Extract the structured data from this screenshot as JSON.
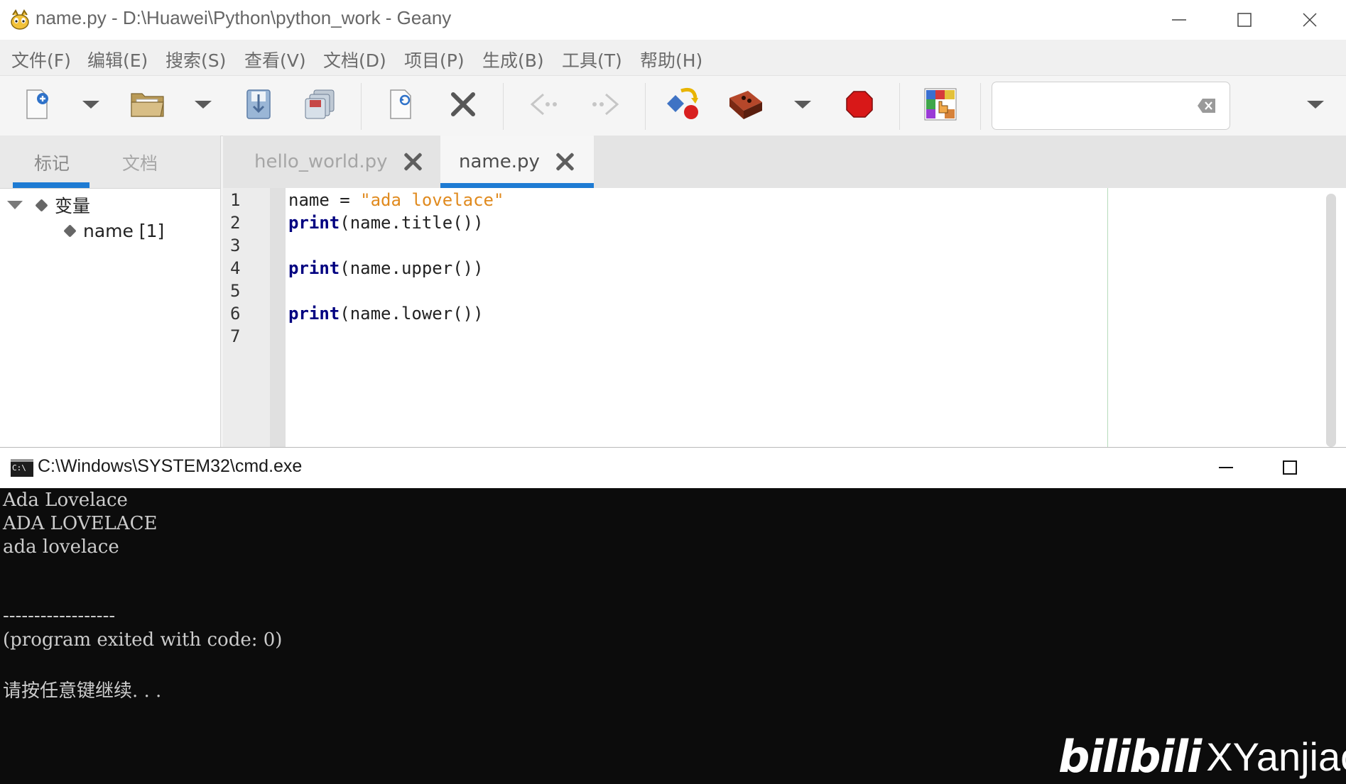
{
  "geany": {
    "title": "name.py - D:\\Huawei\\Python\\python_work - Geany",
    "menu": [
      "文件(F)",
      "编辑(E)",
      "搜索(S)",
      "查看(V)",
      "文档(D)",
      "项目(P)",
      "生成(B)",
      "工具(T)",
      "帮助(H)"
    ],
    "sidebar": {
      "tabs": [
        "标记",
        "文档"
      ],
      "active_tab": 0,
      "tree": {
        "group": "变量",
        "item": "name [1]"
      }
    },
    "editor_tabs": [
      {
        "label": "hello_world.py",
        "active": false
      },
      {
        "label": "name.py",
        "active": true
      }
    ],
    "gutter": [
      "1",
      "2",
      "3",
      "4",
      "5",
      "6",
      "7"
    ],
    "code": {
      "l1_ident": "name",
      "l1_op": " = ",
      "l1_str": "\"ada lovelace\"",
      "l2_kw": "print",
      "l2_rest": "(name.title())",
      "l4_kw": "print",
      "l4_rest": "(name.upper())",
      "l6_kw": "print",
      "l6_rest": "(name.lower())"
    },
    "colors": {
      "accent": "#1e7bd3",
      "keyword": "#000080",
      "string": "#e08a1e"
    }
  },
  "cmd": {
    "title": "C:\\Windows\\SYSTEM32\\cmd.exe",
    "icon_text": "C:\\",
    "output": [
      "Ada Lovelace",
      "ADA LOVELACE",
      "ada lovelace",
      "------------------",
      "(program exited with code: 0)",
      "请按任意键继续. . ."
    ]
  },
  "watermark": {
    "logo": "bilibili",
    "name": "XYanjiao"
  }
}
